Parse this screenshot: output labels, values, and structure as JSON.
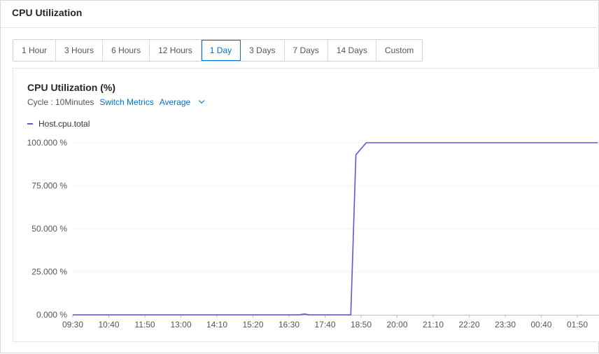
{
  "panel": {
    "title": "CPU Utilization"
  },
  "range_tabs": [
    {
      "label": "1 Hour",
      "active": false
    },
    {
      "label": "3 Hours",
      "active": false
    },
    {
      "label": "6 Hours",
      "active": false
    },
    {
      "label": "12 Hours",
      "active": false
    },
    {
      "label": "1 Day",
      "active": true
    },
    {
      "label": "3 Days",
      "active": false
    },
    {
      "label": "7 Days",
      "active": false
    },
    {
      "label": "14 Days",
      "active": false
    },
    {
      "label": "Custom",
      "active": false
    }
  ],
  "chart_card": {
    "title": "CPU Utilization (%)",
    "cycle_label": "Cycle : 10Minutes",
    "switch_metrics_label": "Switch Metrics",
    "aggregation_label": "Average"
  },
  "colors": {
    "accent": "#0070cc",
    "series": "#6b4fe0",
    "grid": "#e8e8e8"
  },
  "chart_data": {
    "type": "line",
    "title": "CPU Utilization (%)",
    "xlabel": "",
    "ylabel": "",
    "ylim": [
      0,
      100
    ],
    "y_ticks": [
      0,
      25,
      50,
      75,
      100
    ],
    "y_tick_labels": [
      "0.000 %",
      "25.000 %",
      "50.000 %",
      "75.000 %",
      "100.000 %"
    ],
    "x_tick_labels": [
      "09:30",
      "10:40",
      "11:50",
      "13:00",
      "14:10",
      "15:20",
      "16:30",
      "17:40",
      "18:50",
      "20:00",
      "21:10",
      "22:20",
      "23:30",
      "00:40",
      "01:50"
    ],
    "grid": true,
    "legend": "top-left",
    "series": [
      {
        "name": "Host.cpu.total",
        "x": [
          "09:30",
          "16:50",
          "17:00",
          "17:10",
          "18:20",
          "18:30",
          "18:40",
          "19:00",
          "02:30"
        ],
        "values": [
          0,
          0,
          0.5,
          0,
          0,
          0,
          93,
          100,
          100
        ]
      }
    ]
  }
}
